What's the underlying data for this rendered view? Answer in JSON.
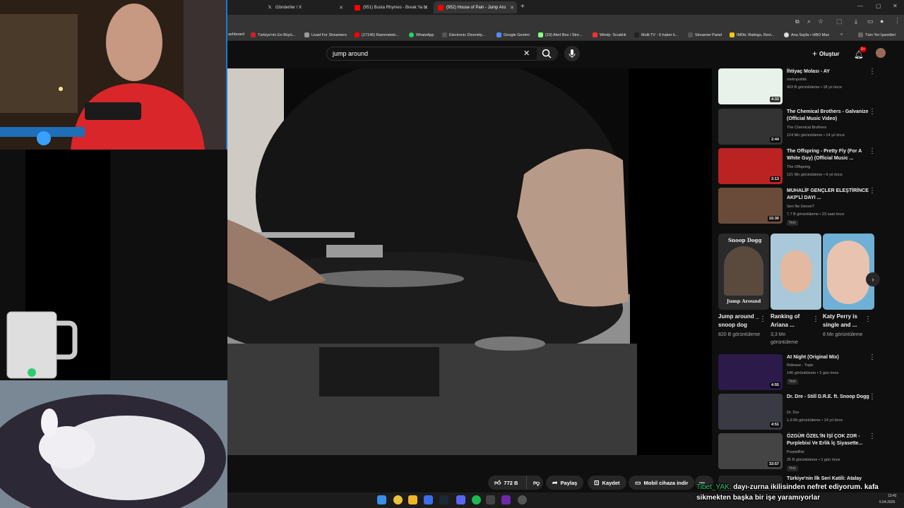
{
  "browser": {
    "tabs": [
      {
        "label": "Gönderiler / X",
        "icon": "x-icon"
      },
      {
        "label": "(951) Busta Rhymes - Break Ya N",
        "icon": "youtube-icon"
      },
      {
        "label": "(952) House of Pain - Jump Aro",
        "icon": "youtube-icon"
      }
    ],
    "new_tab": "+",
    "bookmarks": [
      "ashboard",
      "Türkiye'nin En Büyü...",
      "Livad For Streamers",
      "(17145) Rammstein...",
      "WhatsApp",
      "Electronic Diversity...",
      "Google Gemini",
      "(19) Alert Box / Stre...",
      "Windy: Sıcaklık",
      "Multi TV - 6 haber k...",
      "Streamer Panel",
      "IMDb: Ratings, Revi...",
      "Ana Sayfa • HBO Max"
    ],
    "bookmarks_more": "»",
    "all_bookmarks": "Tüm Yer İşaretleri"
  },
  "youtube": {
    "search_value": "jump around",
    "create_label": "Oluştur",
    "notif_count": "9+"
  },
  "recommendations": [
    {
      "title": "İhtiyaç Molası - AY",
      "channel": "metropolitik",
      "meta": "403 B görüntüleme • 18 yıl önce",
      "duration": "4:33",
      "new": "",
      "verified": false,
      "thumb": "#e8f2ea"
    },
    {
      "title": "The Chemical Brothers - Galvanize (Official Music Video)",
      "channel": "The Chemical Brothers",
      "meta": "124 Mn görüntüleme • 14 yıl önce",
      "duration": "2:44",
      "new": "",
      "verified": true,
      "thumb": "#333"
    },
    {
      "title": "The Offspring - Pretty Fly (For A White Guy) (Official Music ...",
      "channel": "The Offspring",
      "meta": "121 Mn görüntüleme • 9 yıl önce",
      "duration": "3:13",
      "new": "",
      "verified": true,
      "thumb": "#b22"
    },
    {
      "title": "MUHALİF GENÇLER ELEŞTİRİNCE AKP'Lİ DAYI ...",
      "channel": "Sen Ne Dersin?",
      "meta": "7,7 B görüntüleme • 23 saat önce",
      "duration": "15:30",
      "new": "Yeni",
      "verified": true,
      "thumb": "#6a4b3a"
    },
    {
      "title": "At Night (Original Mix)",
      "channel": "Release - Topic",
      "meta": "146 görüntüleme • 2 gün önce",
      "duration": "4:55",
      "new": "Yeni",
      "verified": false,
      "thumb": "#2c1a4a"
    },
    {
      "title": "Dr. Dre - Still D.R.E. ft. Snoop Dogg",
      "channel": "Dr. Dre",
      "meta": "1,6 Mr görüntüleme • 14 yıl önce",
      "duration": "4:51",
      "new": "",
      "verified": true,
      "thumb": "#3a3a44"
    },
    {
      "title": "ÖZGÜR ÖZEL'İN İŞİ ÇOK ZOR - Purplebixi Ve Erlik İç Siyasette...",
      "channel": "PurpleBixi",
      "meta": "25 B görüntüleme • 1 gün önce",
      "duration": "33:57",
      "new": "Yeni",
      "verified": true,
      "thumb": "#444"
    },
    {
      "title": "Türkiye'nin İlk Seri Katili: Atalay",
      "channel": "",
      "meta": "",
      "duration": "",
      "new": "",
      "verified": false,
      "thumb": "#222"
    }
  ],
  "shorts": [
    {
      "title": "Jump around _ snoop dog",
      "views": "820 B görüntüleme",
      "overlay_top": "Snoop Dogg",
      "overlay_bottom": "Jump Around"
    },
    {
      "title": "Ranking of Ariana ...",
      "views": "3,3 Mn görüntüleme",
      "overlay_top": "",
      "overlay_bottom": ""
    },
    {
      "title": "Katy Perry is single and ...",
      "views": "8 Mn görüntüleme",
      "overlay_top": "",
      "overlay_bottom": ""
    }
  ],
  "actions": {
    "like_count": "772 B",
    "share": "Paylaş",
    "save": "Kaydet",
    "cast": "Mobil cihaza indir",
    "more": "•••"
  },
  "chat": {
    "user": "Tibet_YAK:",
    "message": "dayı-zurna ikilisinden nefret ediyorum. kafa sikmekten başka bir işe yaramıyorlar"
  },
  "taskbar": {
    "time": "13:42",
    "date": "5.04.2026"
  },
  "colors": {
    "accent_red": "#ff0000",
    "brand_blue": "#1a7bd6",
    "chat_user": "#2ecc71"
  }
}
